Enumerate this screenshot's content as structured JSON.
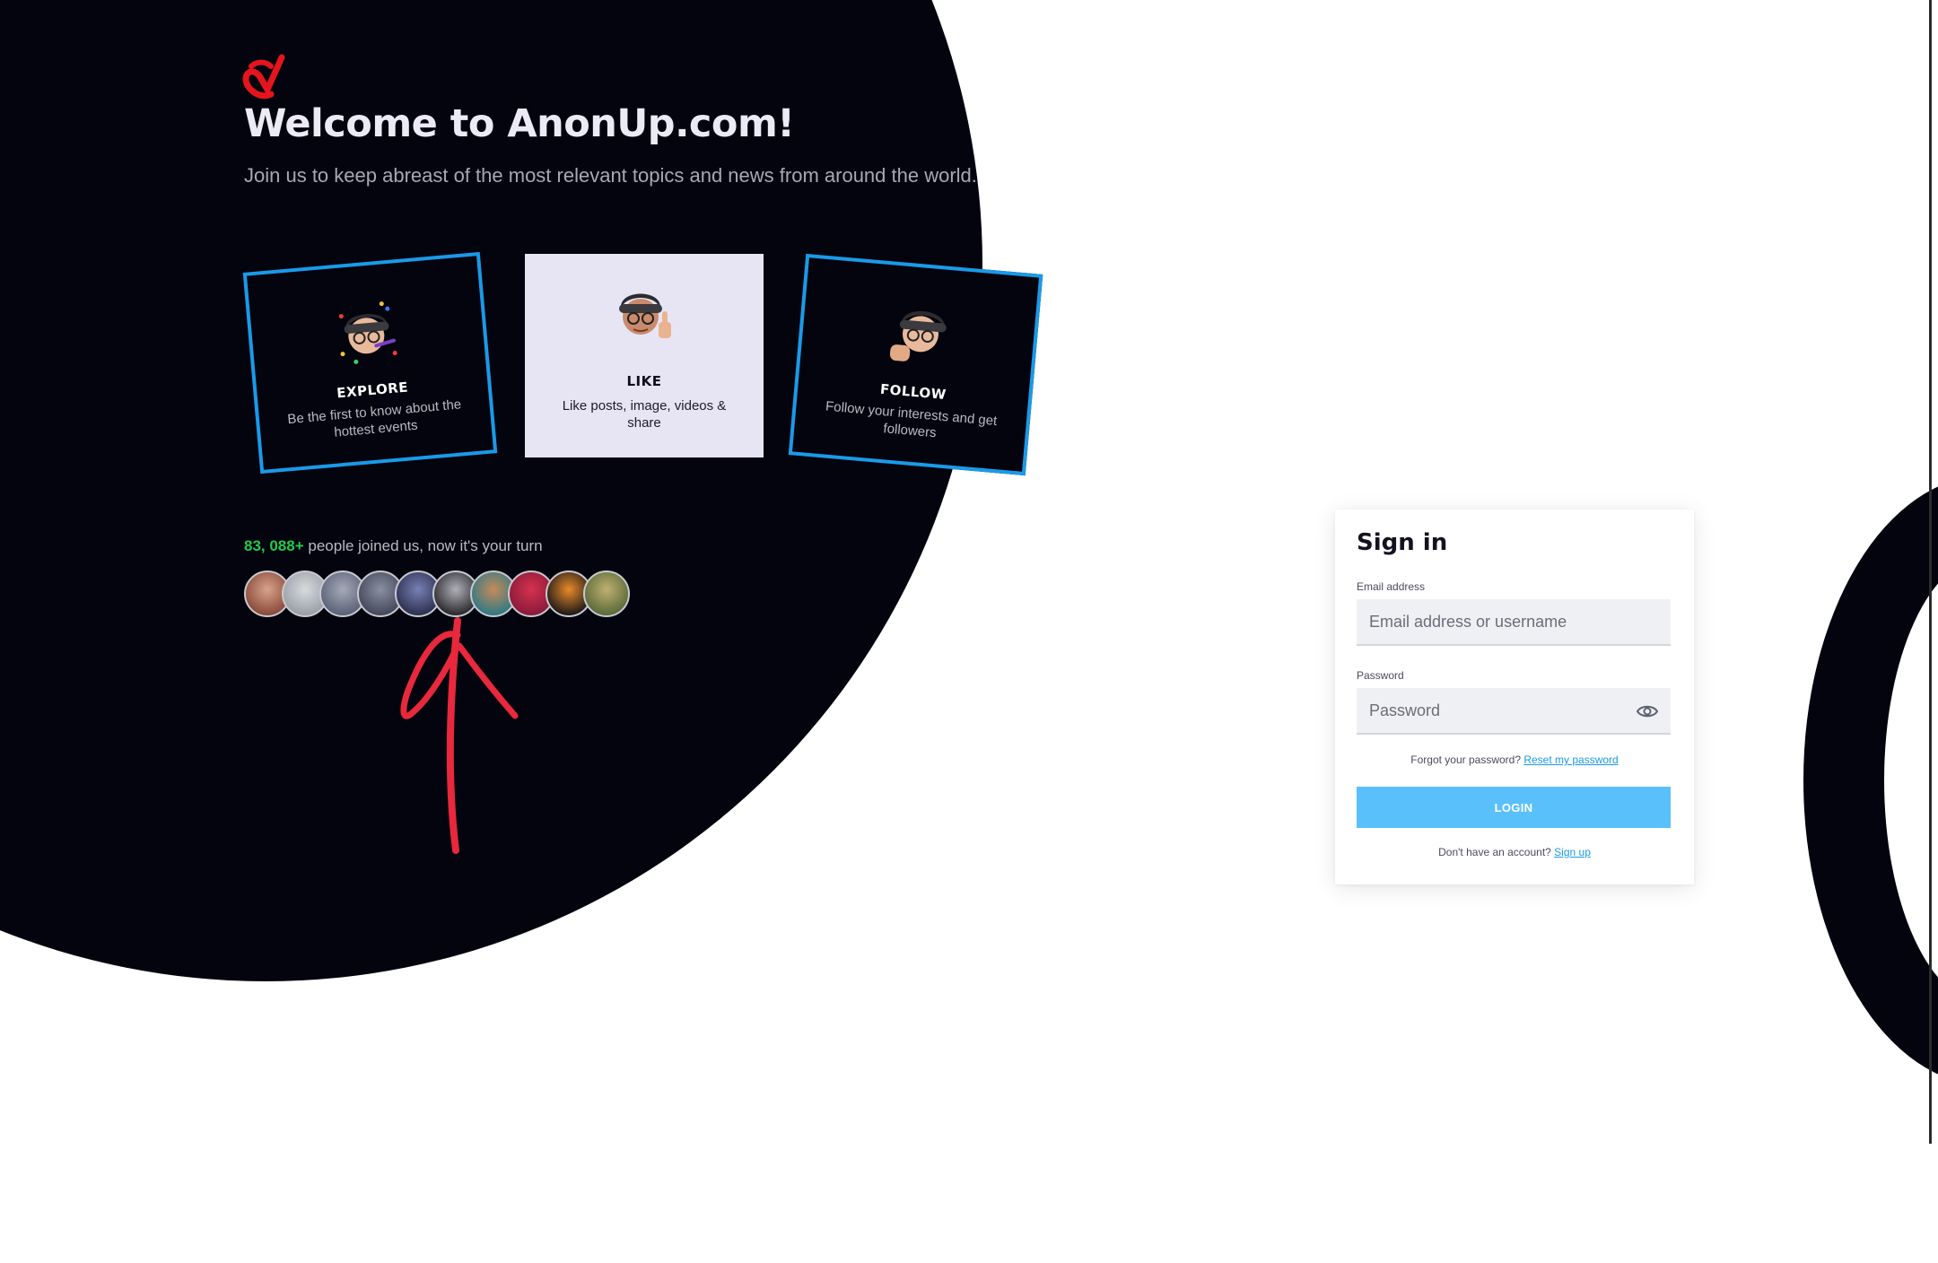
{
  "hero": {
    "title": "Welcome to AnonUp.com!",
    "subtitle": "Join us to keep abreast of the most relevant topics and news from around the world.",
    "logo_icon": "anonup-check-logo-icon",
    "logo_color": "#e5141d"
  },
  "cards": [
    {
      "title": "EXPLORE",
      "description": "Be the first to know about the hottest events",
      "icon": "memoji-party-icon"
    },
    {
      "title": "LIKE",
      "description": "Like posts, image, videos & share",
      "icon": "memoji-thumbs-up-icon"
    },
    {
      "title": "FOLLOW",
      "description": "Follow your interests and get followers",
      "icon": "memoji-fist-bump-icon"
    }
  ],
  "community": {
    "count": "83, 088+",
    "text": " people joined us, now it's your turn",
    "count_color": "#23c94c",
    "avatar_count": 10
  },
  "signin": {
    "title": "Sign in",
    "email_label": "Email address",
    "email_placeholder": "Email address or username",
    "email_value": "",
    "password_label": "Password",
    "password_placeholder": "Password",
    "password_value": "",
    "forgot_text": "Forgot your password? ",
    "reset_link": "Reset my password",
    "login_label": "LOGIN",
    "no_account_text": "Don't have an account? ",
    "signup_link": "Sign up"
  },
  "colors": {
    "background_dark": "#03040e",
    "card_border": "#1a9ae8",
    "like_card_bg": "#e7e5f4",
    "login_button": "#5ac0fb",
    "link": "#1a9ae8",
    "annotation": "#e8283c"
  }
}
